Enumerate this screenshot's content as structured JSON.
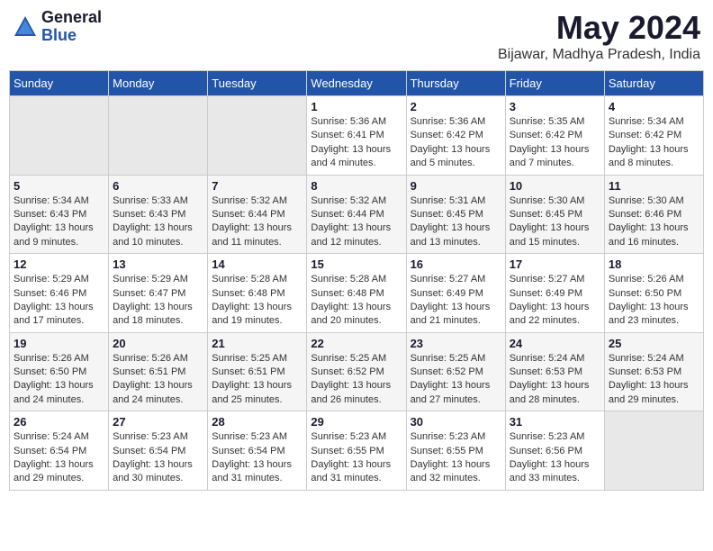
{
  "logo": {
    "general": "General",
    "blue": "Blue"
  },
  "header": {
    "title": "May 2024",
    "subtitle": "Bijawar, Madhya Pradesh, India"
  },
  "weekdays": [
    "Sunday",
    "Monday",
    "Tuesday",
    "Wednesday",
    "Thursday",
    "Friday",
    "Saturday"
  ],
  "weeks": [
    [
      {
        "day": "",
        "empty": true
      },
      {
        "day": "",
        "empty": true
      },
      {
        "day": "",
        "empty": true
      },
      {
        "day": "1",
        "sunrise": "Sunrise: 5:36 AM",
        "sunset": "Sunset: 6:41 PM",
        "daylight": "Daylight: 13 hours and 4 minutes."
      },
      {
        "day": "2",
        "sunrise": "Sunrise: 5:36 AM",
        "sunset": "Sunset: 6:42 PM",
        "daylight": "Daylight: 13 hours and 5 minutes."
      },
      {
        "day": "3",
        "sunrise": "Sunrise: 5:35 AM",
        "sunset": "Sunset: 6:42 PM",
        "daylight": "Daylight: 13 hours and 7 minutes."
      },
      {
        "day": "4",
        "sunrise": "Sunrise: 5:34 AM",
        "sunset": "Sunset: 6:42 PM",
        "daylight": "Daylight: 13 hours and 8 minutes."
      }
    ],
    [
      {
        "day": "5",
        "sunrise": "Sunrise: 5:34 AM",
        "sunset": "Sunset: 6:43 PM",
        "daylight": "Daylight: 13 hours and 9 minutes."
      },
      {
        "day": "6",
        "sunrise": "Sunrise: 5:33 AM",
        "sunset": "Sunset: 6:43 PM",
        "daylight": "Daylight: 13 hours and 10 minutes."
      },
      {
        "day": "7",
        "sunrise": "Sunrise: 5:32 AM",
        "sunset": "Sunset: 6:44 PM",
        "daylight": "Daylight: 13 hours and 11 minutes."
      },
      {
        "day": "8",
        "sunrise": "Sunrise: 5:32 AM",
        "sunset": "Sunset: 6:44 PM",
        "daylight": "Daylight: 13 hours and 12 minutes."
      },
      {
        "day": "9",
        "sunrise": "Sunrise: 5:31 AM",
        "sunset": "Sunset: 6:45 PM",
        "daylight": "Daylight: 13 hours and 13 minutes."
      },
      {
        "day": "10",
        "sunrise": "Sunrise: 5:30 AM",
        "sunset": "Sunset: 6:45 PM",
        "daylight": "Daylight: 13 hours and 15 minutes."
      },
      {
        "day": "11",
        "sunrise": "Sunrise: 5:30 AM",
        "sunset": "Sunset: 6:46 PM",
        "daylight": "Daylight: 13 hours and 16 minutes."
      }
    ],
    [
      {
        "day": "12",
        "sunrise": "Sunrise: 5:29 AM",
        "sunset": "Sunset: 6:46 PM",
        "daylight": "Daylight: 13 hours and 17 minutes."
      },
      {
        "day": "13",
        "sunrise": "Sunrise: 5:29 AM",
        "sunset": "Sunset: 6:47 PM",
        "daylight": "Daylight: 13 hours and 18 minutes."
      },
      {
        "day": "14",
        "sunrise": "Sunrise: 5:28 AM",
        "sunset": "Sunset: 6:48 PM",
        "daylight": "Daylight: 13 hours and 19 minutes."
      },
      {
        "day": "15",
        "sunrise": "Sunrise: 5:28 AM",
        "sunset": "Sunset: 6:48 PM",
        "daylight": "Daylight: 13 hours and 20 minutes."
      },
      {
        "day": "16",
        "sunrise": "Sunrise: 5:27 AM",
        "sunset": "Sunset: 6:49 PM",
        "daylight": "Daylight: 13 hours and 21 minutes."
      },
      {
        "day": "17",
        "sunrise": "Sunrise: 5:27 AM",
        "sunset": "Sunset: 6:49 PM",
        "daylight": "Daylight: 13 hours and 22 minutes."
      },
      {
        "day": "18",
        "sunrise": "Sunrise: 5:26 AM",
        "sunset": "Sunset: 6:50 PM",
        "daylight": "Daylight: 13 hours and 23 minutes."
      }
    ],
    [
      {
        "day": "19",
        "sunrise": "Sunrise: 5:26 AM",
        "sunset": "Sunset: 6:50 PM",
        "daylight": "Daylight: 13 hours and 24 minutes."
      },
      {
        "day": "20",
        "sunrise": "Sunrise: 5:26 AM",
        "sunset": "Sunset: 6:51 PM",
        "daylight": "Daylight: 13 hours and 24 minutes."
      },
      {
        "day": "21",
        "sunrise": "Sunrise: 5:25 AM",
        "sunset": "Sunset: 6:51 PM",
        "daylight": "Daylight: 13 hours and 25 minutes."
      },
      {
        "day": "22",
        "sunrise": "Sunrise: 5:25 AM",
        "sunset": "Sunset: 6:52 PM",
        "daylight": "Daylight: 13 hours and 26 minutes."
      },
      {
        "day": "23",
        "sunrise": "Sunrise: 5:25 AM",
        "sunset": "Sunset: 6:52 PM",
        "daylight": "Daylight: 13 hours and 27 minutes."
      },
      {
        "day": "24",
        "sunrise": "Sunrise: 5:24 AM",
        "sunset": "Sunset: 6:53 PM",
        "daylight": "Daylight: 13 hours and 28 minutes."
      },
      {
        "day": "25",
        "sunrise": "Sunrise: 5:24 AM",
        "sunset": "Sunset: 6:53 PM",
        "daylight": "Daylight: 13 hours and 29 minutes."
      }
    ],
    [
      {
        "day": "26",
        "sunrise": "Sunrise: 5:24 AM",
        "sunset": "Sunset: 6:54 PM",
        "daylight": "Daylight: 13 hours and 29 minutes."
      },
      {
        "day": "27",
        "sunrise": "Sunrise: 5:23 AM",
        "sunset": "Sunset: 6:54 PM",
        "daylight": "Daylight: 13 hours and 30 minutes."
      },
      {
        "day": "28",
        "sunrise": "Sunrise: 5:23 AM",
        "sunset": "Sunset: 6:54 PM",
        "daylight": "Daylight: 13 hours and 31 minutes."
      },
      {
        "day": "29",
        "sunrise": "Sunrise: 5:23 AM",
        "sunset": "Sunset: 6:55 PM",
        "daylight": "Daylight: 13 hours and 31 minutes."
      },
      {
        "day": "30",
        "sunrise": "Sunrise: 5:23 AM",
        "sunset": "Sunset: 6:55 PM",
        "daylight": "Daylight: 13 hours and 32 minutes."
      },
      {
        "day": "31",
        "sunrise": "Sunrise: 5:23 AM",
        "sunset": "Sunset: 6:56 PM",
        "daylight": "Daylight: 13 hours and 33 minutes."
      },
      {
        "day": "",
        "empty": true
      }
    ]
  ]
}
